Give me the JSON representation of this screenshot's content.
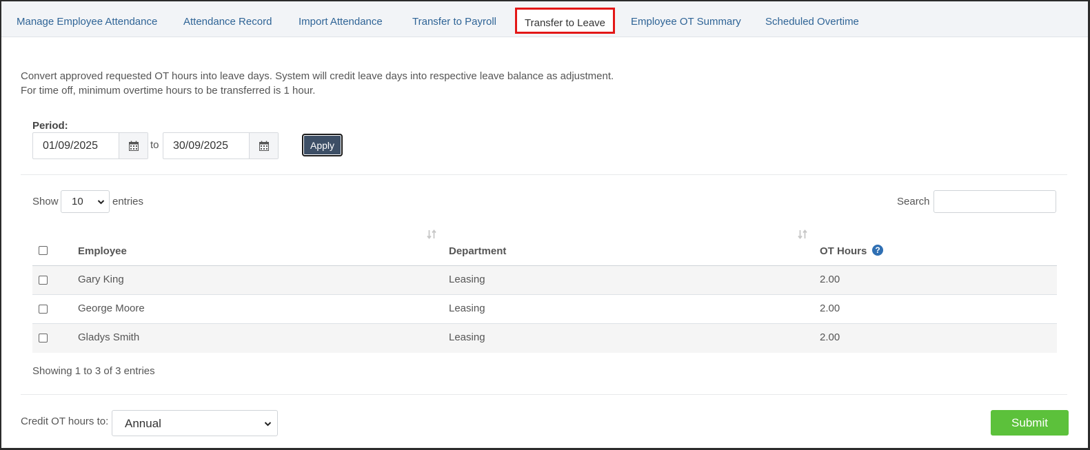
{
  "tabs": [
    {
      "label": "Manage Employee Attendance"
    },
    {
      "label": "Attendance Record"
    },
    {
      "label": "Import Attendance"
    },
    {
      "label": "Transfer to Payroll"
    },
    {
      "label": "Transfer to Leave",
      "active": true
    },
    {
      "label": "Employee OT Summary"
    },
    {
      "label": "Scheduled Overtime"
    }
  ],
  "description": {
    "line1": "Convert approved requested OT hours into leave days. System will credit leave days into respective leave balance as adjustment.",
    "line2": "For time off, minimum overtime hours to be transferred is 1 hour."
  },
  "period": {
    "label": "Period:",
    "from": "01/09/2025",
    "to_label": "to",
    "to": "30/09/2025",
    "apply_label": "Apply"
  },
  "table_controls": {
    "show_label": "Show",
    "entries_value": "10",
    "entries_label": "entries",
    "search_label": "Search",
    "search_value": ""
  },
  "table": {
    "columns": [
      "Employee",
      "Department",
      "OT Hours"
    ],
    "rows": [
      {
        "employee": "Gary King",
        "department": "Leasing",
        "ot_hours": "2.00"
      },
      {
        "employee": "George Moore",
        "department": "Leasing",
        "ot_hours": "2.00"
      },
      {
        "employee": "Gladys Smith",
        "department": "Leasing",
        "ot_hours": "2.00"
      }
    ],
    "info": "Showing 1 to 3 of 3 entries"
  },
  "footer": {
    "credit_label": "Credit OT hours to:",
    "credit_value": "Annual",
    "submit_label": "Submit"
  },
  "colors": {
    "tab_link": "#2f6496",
    "active_tab_border": "#e31717",
    "apply_bg": "#3d4f66",
    "submit_bg": "#5cc13b",
    "help_icon": "#2f6fb3"
  }
}
